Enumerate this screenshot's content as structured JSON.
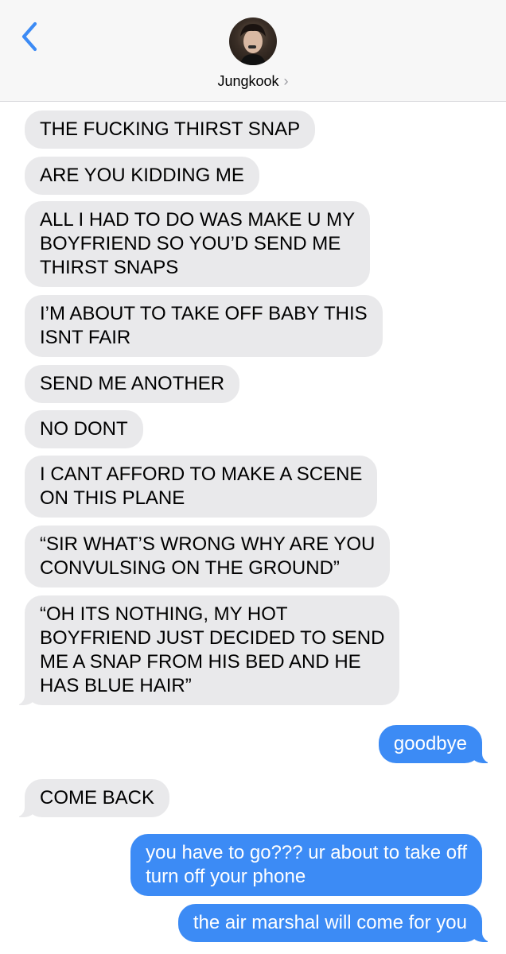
{
  "header": {
    "back_icon": "chevron-left-icon",
    "contact_name": "Jungkook",
    "contact_chevron": "›",
    "accent_color": "#3c8bf5"
  },
  "messages": [
    {
      "from": "them",
      "text": "THE FUCKING THIRST SNAP"
    },
    {
      "from": "them",
      "text": "ARE YOU KIDDING ME"
    },
    {
      "from": "them",
      "text": "ALL I HAD TO DO WAS MAKE U MY\nBOYFRIEND SO YOU’D SEND ME\nTHIRST SNAPS"
    },
    {
      "from": "them",
      "text": "I’M ABOUT TO TAKE OFF BABY THIS\nISNT FAIR"
    },
    {
      "from": "them",
      "text": "SEND ME ANOTHER"
    },
    {
      "from": "them",
      "text": "NO DONT"
    },
    {
      "from": "them",
      "text": "I CANT AFFORD TO MAKE A SCENE\nON THIS PLANE"
    },
    {
      "from": "them",
      "text": "“SIR WHAT’S WRONG WHY ARE YOU\nCONVULSING ON THE GROUND”"
    },
    {
      "from": "them",
      "text": "“OH ITS NOTHING, MY HOT\nBOYFRIEND JUST DECIDED TO SEND\nME A SNAP FROM HIS BED AND HE\nHAS BLUE HAIR”"
    },
    {
      "from": "me",
      "text": "goodbye"
    },
    {
      "from": "them",
      "text": "COME BACK"
    },
    {
      "from": "me",
      "text": "you have to go??? ur about to take off\nturn off your phone"
    },
    {
      "from": "me",
      "text": "the air marshal will come for you"
    }
  ]
}
